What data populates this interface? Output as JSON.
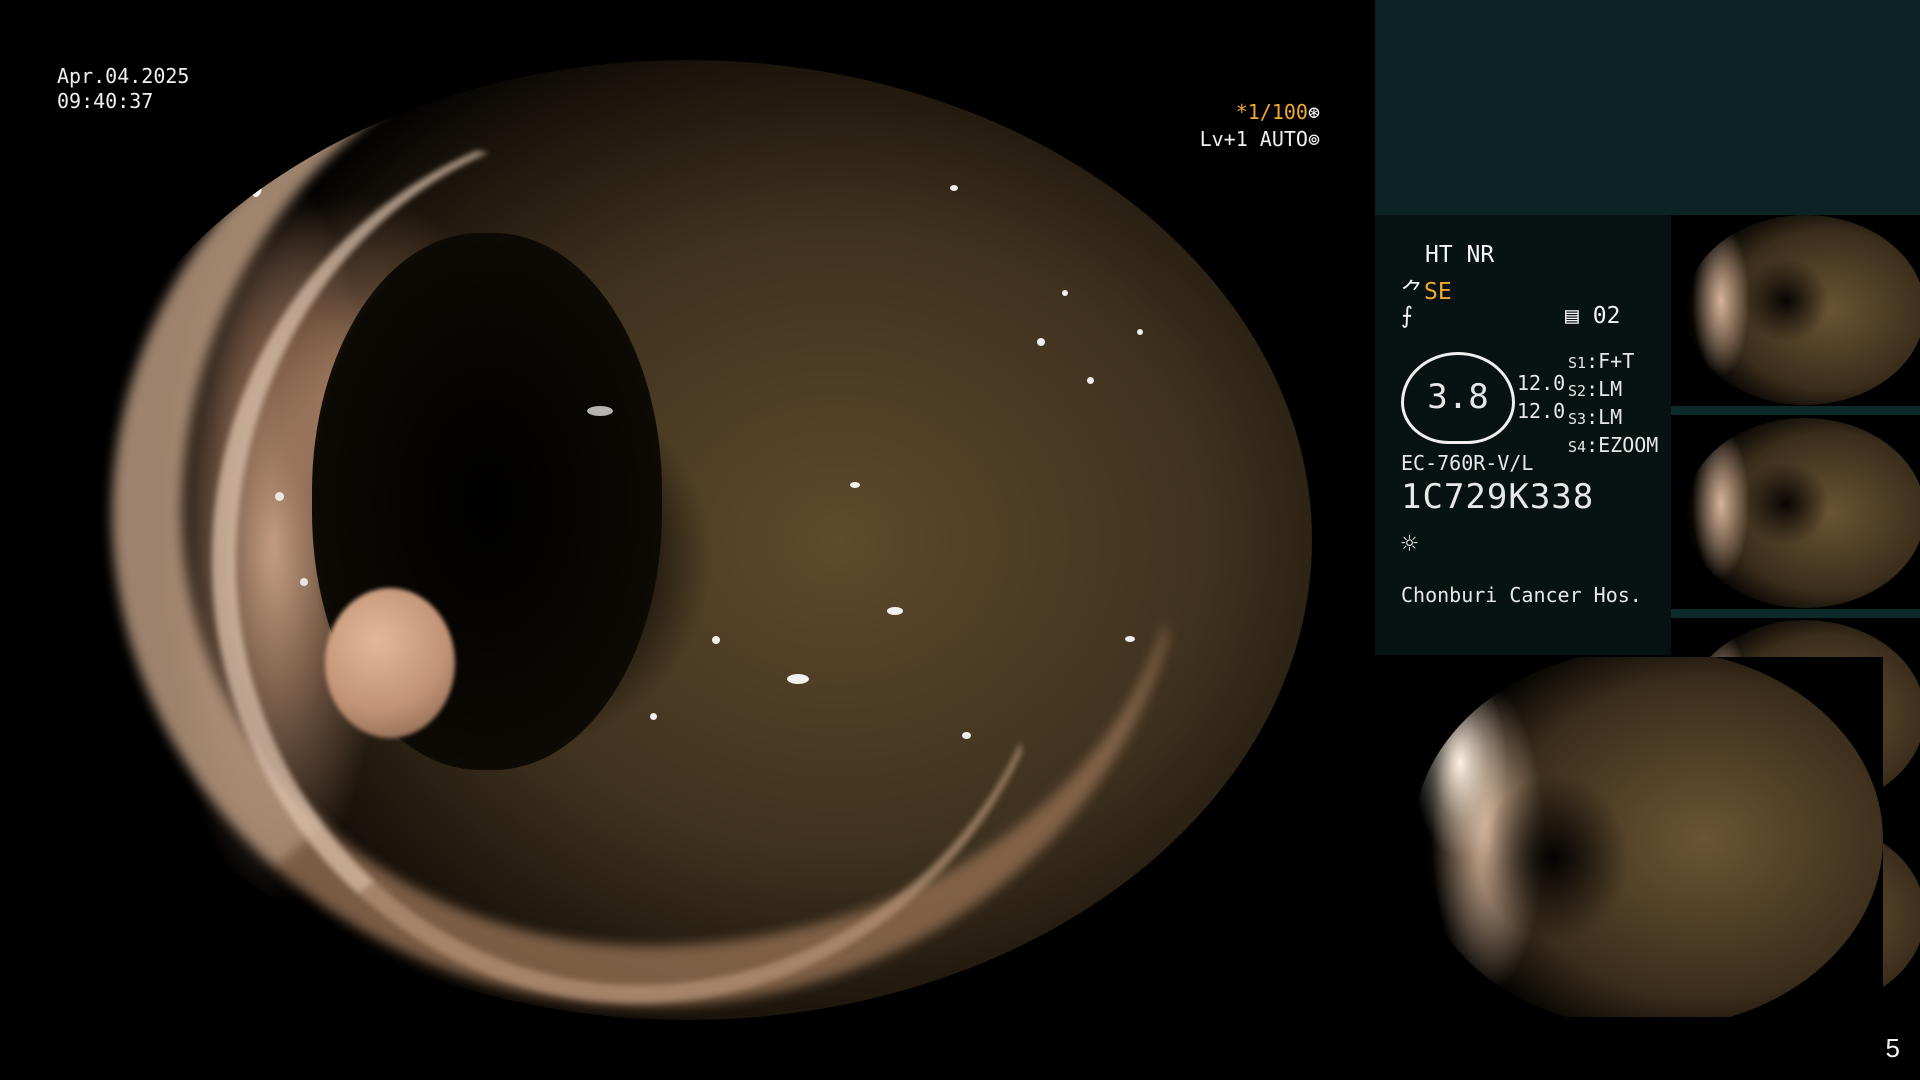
{
  "overlay": {
    "date": "Apr.04.2025",
    "time": "09:40:37",
    "shutter": "*1/100",
    "shutter_icon": "aperture-icon",
    "level": "Lv+1 AUTO",
    "level_icon": "auto-iris-icon"
  },
  "panel": {
    "line1": "HT NR",
    "se_label": "SE",
    "se_icon": "structure-enhance-icon",
    "color_icon": "color-mode-icon",
    "mem_icon": "memory-icon",
    "mem_value": "02",
    "dial_value": "3.8",
    "num_a": "12.0",
    "num_b": "12.0",
    "s1_key": "S1",
    "s1_val": "F+T",
    "s2_key": "S2",
    "s2_val": "LM",
    "s3_key": "S3",
    "s3_val": "LM",
    "s4_key": "S4",
    "s4_val": "EZOOM",
    "model": "EC-760R-V/L",
    "serial": "1C729K338",
    "light_icon": "sun-icon",
    "hospital": "Chonburi Cancer Hos."
  },
  "page_number": "5",
  "colors": {
    "accent_orange": "#f0a830",
    "panel_teal": "#0c2324",
    "info_bg": "#071312"
  }
}
